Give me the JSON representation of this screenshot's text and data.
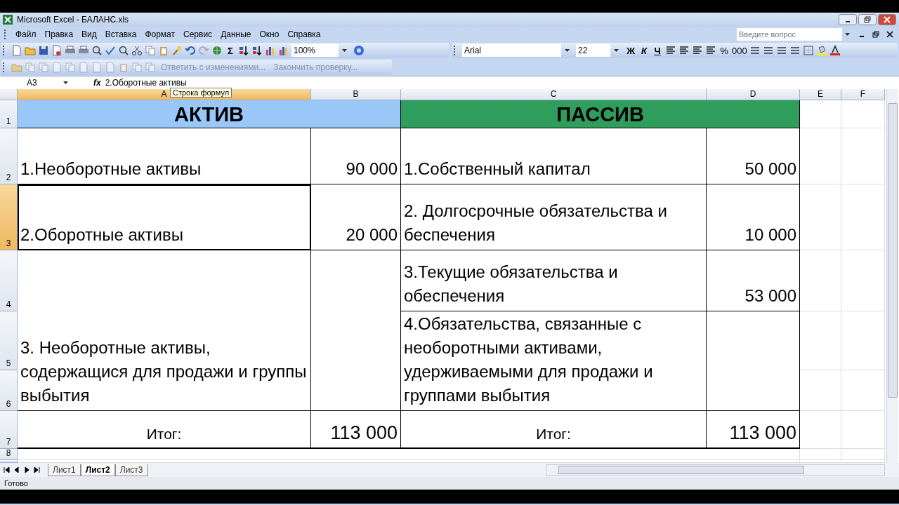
{
  "window": {
    "title": "Microsoft Excel - БАЛАНС.xls"
  },
  "menu": [
    "Файл",
    "Правка",
    "Вид",
    "Вставка",
    "Формат",
    "Сервис",
    "Данные",
    "Окно",
    "Справка"
  ],
  "help_box": {
    "placeholder": "Введите вопрос"
  },
  "standard_toolbar": {
    "sum": "Σ",
    "zoom": "100%"
  },
  "format_toolbar": {
    "font": "Arial",
    "size": "22",
    "bold": "Ж",
    "italic": "К",
    "underline": "Ч",
    "percent": "%",
    "thousands": "000"
  },
  "review_toolbar": [
    {
      "label": "Ответить с изменениями...",
      "disabled": true
    },
    {
      "label": "Закончить проверку...",
      "disabled": true
    }
  ],
  "formula_bar": {
    "name_box": "A3",
    "fx": "fx",
    "value": "2.Оборотные активы",
    "tooltip": "Строка формул"
  },
  "columns": [
    {
      "label": "A",
      "selected": true
    },
    {
      "label": "B",
      "selected": false
    },
    {
      "label": "C",
      "selected": false
    },
    {
      "label": "D",
      "selected": false
    },
    {
      "label": "E",
      "selected": false
    },
    {
      "label": "F",
      "selected": false
    }
  ],
  "rows": [
    {
      "label": "1",
      "selected": false
    },
    {
      "label": "2",
      "selected": false
    },
    {
      "label": "3",
      "selected": true
    },
    {
      "label": "4",
      "selected": false
    },
    {
      "label": "5",
      "selected": false
    },
    {
      "label": "6",
      "selected": false
    },
    {
      "label": "7",
      "selected": false
    },
    {
      "label": "8",
      "selected": false
    }
  ],
  "balance": {
    "assets_title": "АКТИВ",
    "liabilities_title": "ПАССИВ",
    "assets": [
      {
        "label": "1.Необоротные активы",
        "amount": "90 000",
        "selected": false
      },
      {
        "label": "2.Оборотные активы",
        "amount": "20 000",
        "selected": true
      },
      {
        "label": "3. Необоротные активы, содержащися для продажи и группы выбытия",
        "selected": false
      }
    ],
    "liabilities": [
      {
        "label": "1.Собственный капитал",
        "amount": "50 000"
      },
      {
        "label": "2. Долгосрочные обязательства и беспечения",
        "amount": "10 000"
      },
      {
        "label": "3.Текущие обязательства и обеспечения",
        "amount": "53 000"
      },
      {
        "label": "4.Обязательства, связанные с необоротными активами, удерживаемыми для продажи и группами выбытия"
      }
    ],
    "assets_total": {
      "label": "Итог:",
      "amount": "113 000"
    },
    "liabilities_total": {
      "label": "Итог:",
      "amount": "113 000"
    }
  },
  "sheets": [
    {
      "label": "Лист1",
      "selected": false
    },
    {
      "label": "Лист2",
      "selected": true
    },
    {
      "label": "Лист3",
      "selected": false
    }
  ],
  "status_bar": "Готово"
}
